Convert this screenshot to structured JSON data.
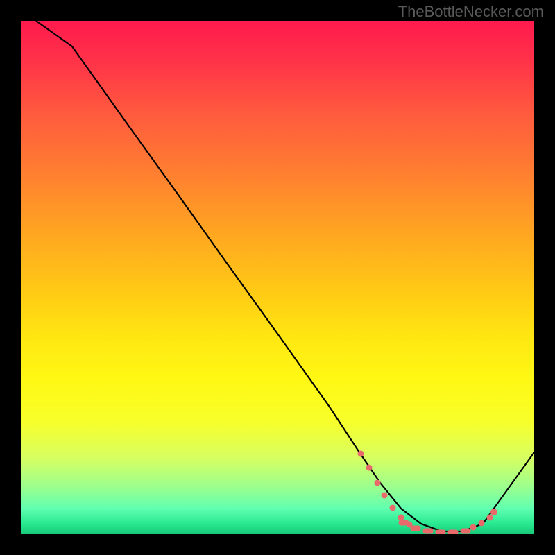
{
  "watermark": "TheBottleNecker.com",
  "chart_data": {
    "type": "line",
    "title": "",
    "xlabel": "",
    "ylabel": "",
    "xlim": [
      0,
      100
    ],
    "ylim": [
      0,
      100
    ],
    "gradient_meaning": "bottleneck severity (red=high, green=low)",
    "series": [
      {
        "name": "bottleneck-curve",
        "x": [
          3,
          10,
          20,
          30,
          40,
          50,
          60,
          66,
          70,
          74,
          78,
          82,
          86,
          90,
          100
        ],
        "y": [
          100,
          95,
          81,
          67,
          53,
          39,
          25,
          16,
          10,
          5,
          2,
          0.5,
          0.5,
          2,
          16
        ]
      }
    ],
    "markers": {
      "color": "#e86a6a",
      "style": "circles-and-dashes",
      "approx_x_range": [
        66,
        92
      ],
      "description": "highlighted near-zero valley points"
    }
  }
}
